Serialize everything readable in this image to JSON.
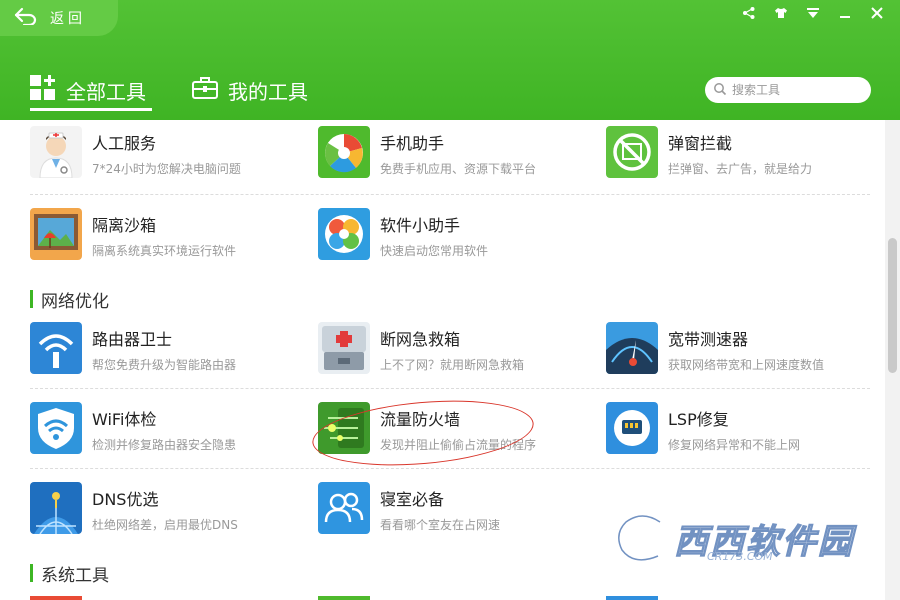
{
  "header": {
    "back_label": "返回",
    "tabs": [
      {
        "label": "全部工具",
        "icon": "grid-plus-icon",
        "active": true
      },
      {
        "label": "我的工具",
        "icon": "toolbox-icon",
        "active": false
      }
    ],
    "search_placeholder": "搜索工具",
    "window_controls": [
      "share-icon",
      "shirt-skin-icon",
      "menu-icon",
      "minimize-icon",
      "close-icon"
    ]
  },
  "tools": {
    "top": [
      {
        "name": "人工服务",
        "desc": "7*24小时为您解决电脑问题",
        "icon": "doctor-icon"
      },
      {
        "name": "手机助手",
        "desc": "免费手机应用、资源下载平台",
        "icon": "phone-assistant-icon"
      },
      {
        "name": "弹窗拦截",
        "desc": "拦弹窗、去广告，就是给力",
        "icon": "popup-block-icon"
      },
      {
        "name": "隔离沙箱",
        "desc": "隔离系统真实环境运行软件",
        "icon": "sandbox-icon"
      },
      {
        "name": "软件小助手",
        "desc": "快速启动您常用软件",
        "icon": "software-helper-icon"
      }
    ],
    "network": [
      {
        "name": "路由器卫士",
        "desc": "帮您免费升级为智能路由器",
        "icon": "router-guard-icon"
      },
      {
        "name": "断网急救箱",
        "desc": "上不了网？就用断网急救箱",
        "icon": "first-aid-box-icon"
      },
      {
        "name": "宽带测速器",
        "desc": "获取网络带宽和上网速度数值",
        "icon": "speedometer-icon"
      },
      {
        "name": "WiFi体检",
        "desc": "检测并修复路由器安全隐患",
        "icon": "wifi-shield-icon"
      },
      {
        "name": "流量防火墙",
        "desc": "发现并阻止偷偷占流量的程序",
        "icon": "traffic-firewall-icon"
      },
      {
        "name": "LSP修复",
        "desc": "修复网络异常和不能上网",
        "icon": "lsp-repair-icon"
      },
      {
        "name": "DNS优选",
        "desc": "杜绝网络差，启用最优DNS",
        "icon": "dns-globe-icon"
      },
      {
        "name": "寝室必备",
        "desc": "看看哪个室友在占网速",
        "icon": "dorm-users-icon"
      }
    ]
  },
  "sections": {
    "network": "网络优化",
    "system": "系统工具"
  },
  "watermark": {
    "text": "西西软件园",
    "sub": "CR173.COM"
  },
  "colors": {
    "header_green": "#3fb424",
    "accent_green": "#3db624",
    "highlight_red": "#d9362b"
  }
}
